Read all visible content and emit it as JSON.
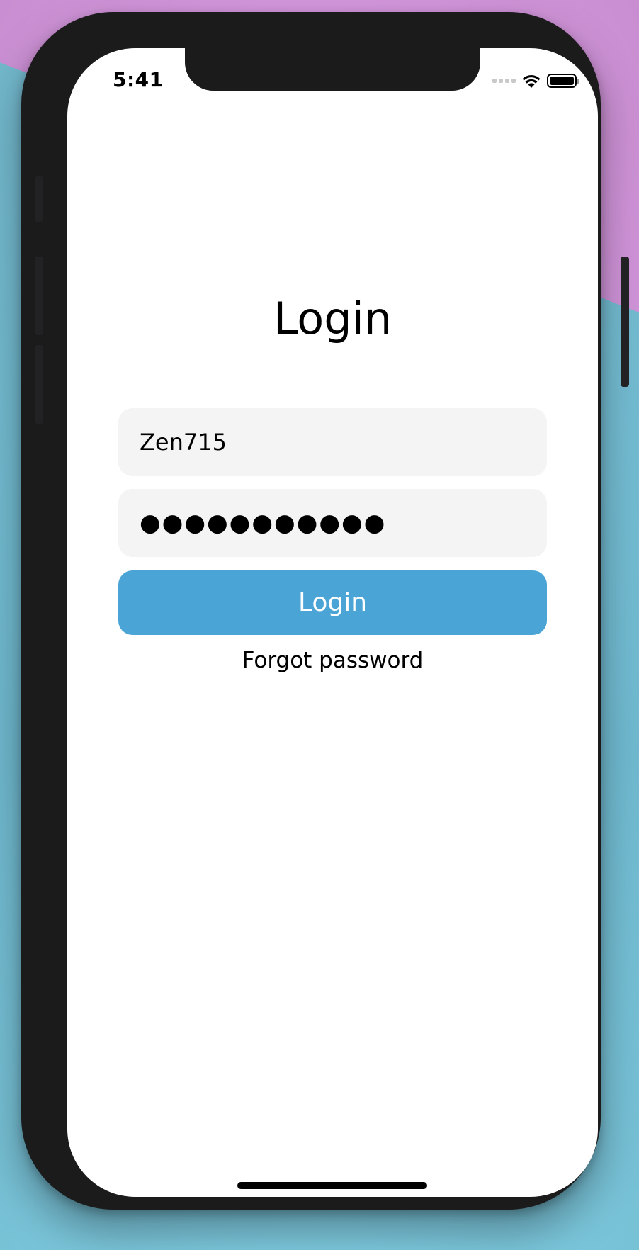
{
  "status_bar": {
    "time": "5:41",
    "signal_icon": "cellular-signal-icon",
    "wifi_icon": "wifi-icon",
    "battery_icon": "battery-icon",
    "battery_level": 1.0
  },
  "login_screen": {
    "title": "Login",
    "username_value": "Zen715",
    "password_masked": "●●●●●●●●●●●",
    "login_button_label": "Login",
    "forgot_password_label": "Forgot password"
  },
  "colors": {
    "accent": "#4aa5d6",
    "field_background": "#f4f4f4",
    "background_blue": "#7cc6dc",
    "background_pink": "#d99ae2",
    "device_frame": "#1b1b1c"
  }
}
